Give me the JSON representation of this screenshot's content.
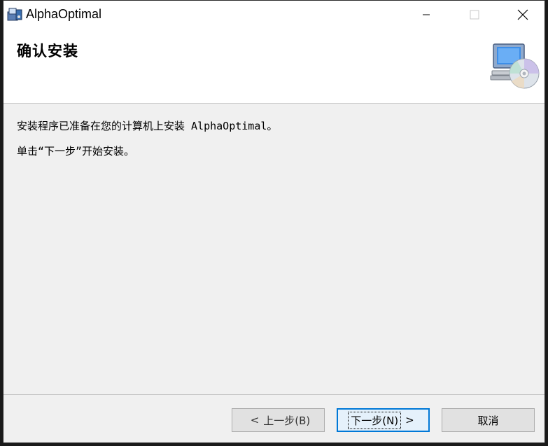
{
  "window": {
    "title": "AlphaOptimal",
    "icon": "installer-package-icon"
  },
  "window_controls": {
    "minimize_icon": "minimize-icon",
    "maximize_icon": "maximize-icon",
    "close_icon": "close-icon"
  },
  "banner": {
    "title": "确认安装",
    "icon": "computer-with-cd-icon"
  },
  "body": {
    "line1": "安装程序已准备在您的计算机上安装 AlphaOptimal。",
    "line2": "单击“下一步”开始安装。"
  },
  "buttons": {
    "back_chevron": "<",
    "back_label": "上一步(B)",
    "next_label": "下一步(N)",
    "next_chevron": ">",
    "cancel_label": "取消"
  },
  "colors": {
    "focus_border": "#0078d7",
    "button_face": "#e1e1e1",
    "dialog_background": "#f0f0f0"
  }
}
